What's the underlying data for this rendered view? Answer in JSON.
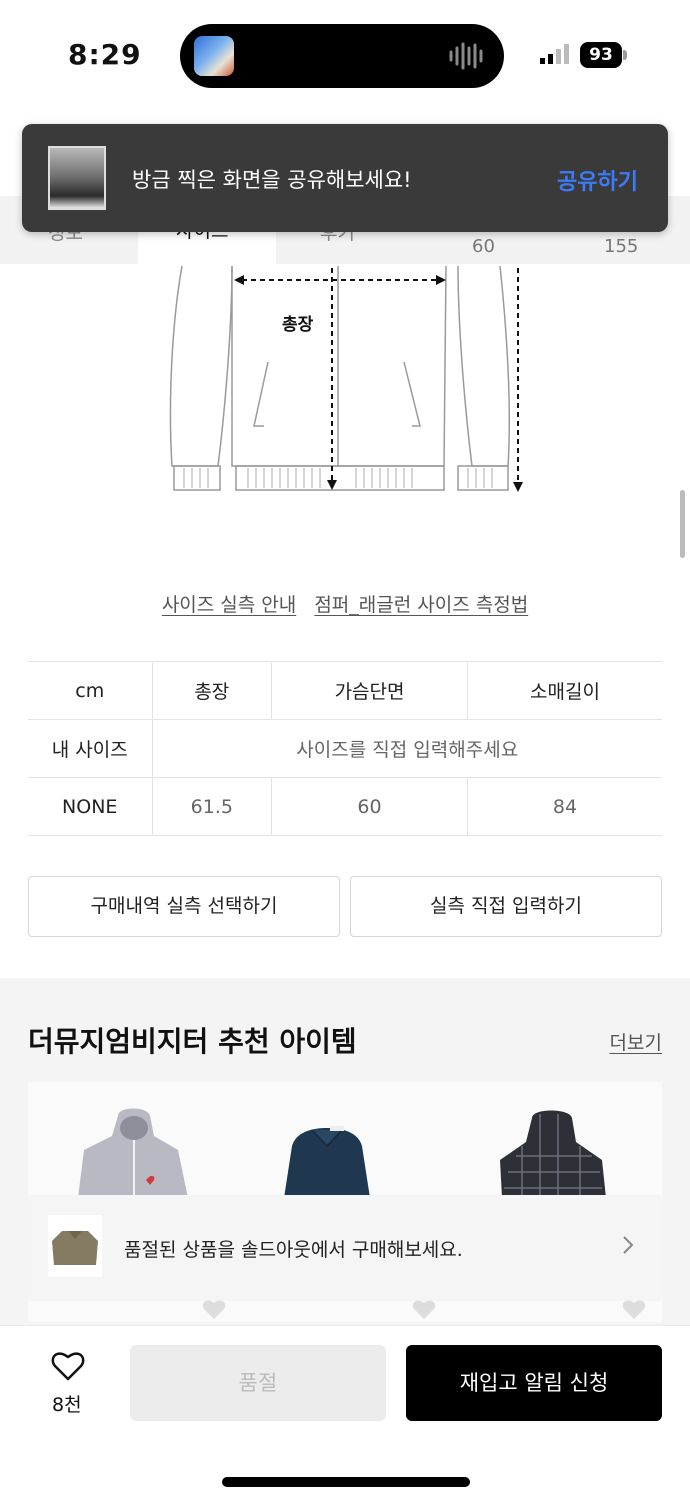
{
  "status_bar": {
    "time": "8:29",
    "battery": "93"
  },
  "tabs": {
    "items": [
      "정보",
      "사이즈",
      "후기"
    ],
    "active_index": 1,
    "values": [
      "60",
      "155"
    ]
  },
  "toast": {
    "message": "방금 찍은 화면을 공유해보세요!",
    "action": "공유하기"
  },
  "diagram": {
    "label": "총장"
  },
  "size_links": [
    "사이즈 실측 안내",
    "점퍼_래글런 사이즈 측정법"
  ],
  "size_table": {
    "headers": [
      "cm",
      "총장",
      "가슴단면",
      "소매길이"
    ],
    "my_size": {
      "label": "내 사이즈",
      "placeholder": "사이즈를 직접 입력해주세요"
    },
    "rows": [
      {
        "label": "NONE",
        "values": [
          "61.5",
          "60",
          "84"
        ]
      }
    ]
  },
  "actions": {
    "history": "구매내역 실측 선택하기",
    "manual": "실측 직접 입력하기"
  },
  "recommend": {
    "title": "더뮤지엄비지터 추천 아이템",
    "more": "더보기"
  },
  "soldout_banner": {
    "text": "품절된 상품을 솔드아웃에서 구매해보세요."
  },
  "bottom_bar": {
    "like_count": "8천",
    "soldout_label": "품절",
    "restock_label": "재입고 알림 신청"
  },
  "colors": {
    "accent_link": "#3b7cf6",
    "primary_button": "#000000",
    "disabled_button": "#ececec"
  }
}
